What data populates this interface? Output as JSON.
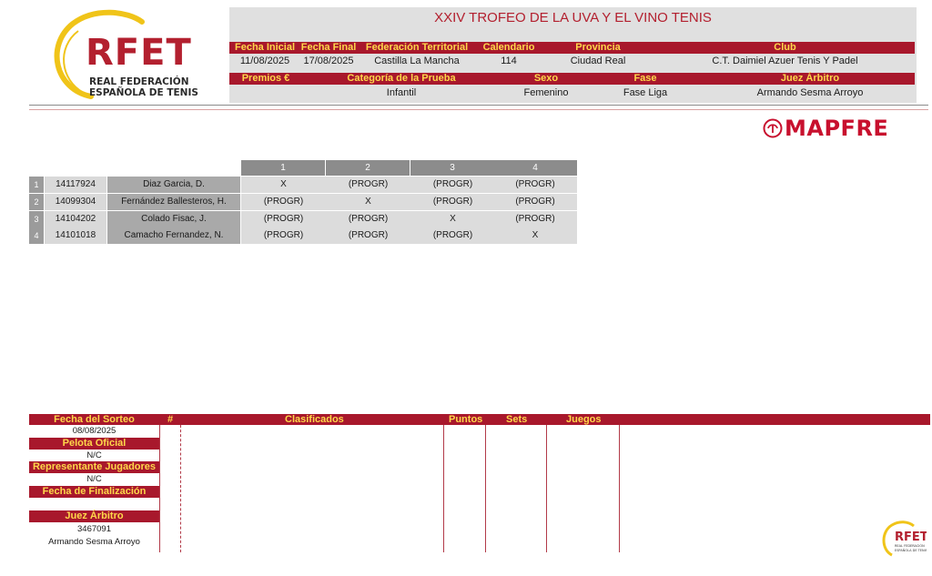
{
  "logo": {
    "letters": "RFET",
    "line1": "REAL FEDERACIÓN",
    "line2": "ESPAÑOLA DE TENIS"
  },
  "event": {
    "title": "XXIV TROFEO DE LA UVA Y EL VINO TENIS"
  },
  "info_row1": {
    "headers": [
      "Fecha Inicial",
      "Fecha Final",
      "Federación Territorial",
      "Calendario",
      "Provincia",
      "Club"
    ],
    "values": [
      "11/08/2025",
      "17/08/2025",
      "Castilla La Mancha",
      "114",
      "Ciudad Real",
      "C.T. Daimiel Azuer Tenis Y Padel"
    ]
  },
  "info_row2": {
    "headers": [
      "Premios €",
      "Categoría de la Prueba",
      "Sexo",
      "Fase",
      "Juez Árbitro"
    ],
    "values": [
      "",
      "Infantil",
      "Femenino",
      "Fase Liga",
      "Armando Sesma Arroyo"
    ]
  },
  "sponsor": {
    "name": "MAPFRE",
    "icon": "mapfre-emblem-icon",
    "color": "#c8102e"
  },
  "grid": {
    "columns": [
      "1",
      "2",
      "3",
      "4"
    ],
    "rows": [
      {
        "num": "1",
        "id": "14117924",
        "name": "Diaz Garcia, D.",
        "cells": [
          "X",
          "(PROGR)",
          "(PROGR)",
          "(PROGR)"
        ]
      },
      {
        "num": "2",
        "id": "14099304",
        "name": "Fernández Ballesteros, H.",
        "cells": [
          "(PROGR)",
          "X",
          "(PROGR)",
          "(PROGR)"
        ]
      },
      {
        "num": "3",
        "id": "14104202",
        "name": "Colado Fisac, J.",
        "cells": [
          "(PROGR)",
          "(PROGR)",
          "X",
          "(PROGR)"
        ]
      },
      {
        "num": "4",
        "id": "14101018",
        "name": "Camacho Fernandez, N.",
        "cells": [
          "(PROGR)",
          "(PROGR)",
          "(PROGR)",
          "X"
        ]
      }
    ]
  },
  "bottom": {
    "headers": {
      "hash": "#",
      "clasificados": "Clasificados",
      "puntos": "Puntos",
      "sets": "Sets",
      "juegos": "Juegos"
    },
    "fields": [
      {
        "label": "Fecha del Sorteo",
        "value": "08/08/2025"
      },
      {
        "label": "Pelota Oficial",
        "value": "N/C"
      },
      {
        "label": "Representante Jugadores",
        "value": "N/C"
      },
      {
        "label": "Fecha de Finalización",
        "value": ""
      },
      {
        "label": "Juez Árbitro",
        "value": "3467091",
        "value2": "Armando Sesma Arroyo"
      }
    ]
  },
  "colors": {
    "brand_red": "#a8182c",
    "header_text": "#ffd84a",
    "title_red": "#b3202f",
    "logo_yellow": "#f0c419"
  }
}
